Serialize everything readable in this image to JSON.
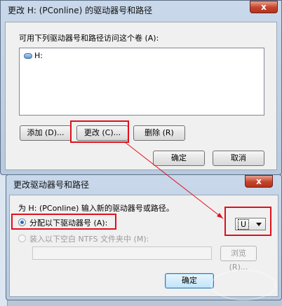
{
  "dialog1": {
    "title": "更改 H: (PConline) 的驱动器号和路径",
    "instruction": "可用下列驱动器号和路径访问这个卷 (A):",
    "list_items": [
      {
        "label": "H:"
      }
    ],
    "add_label": "添加 (D)...",
    "change_label": "更改 (C)...",
    "delete_label": "删除 (R)",
    "ok_label": "确定",
    "cancel_label": "取消"
  },
  "dialog2": {
    "title": "更改驱动器号和路径",
    "close_label": "x",
    "instruction": "为 H: (PConline) 输入新的驱动器号或路径。",
    "assign_label": "分配以下驱动器号 (A):",
    "mount_label": "装入以下空白 NTFS 文件夹中 (M):",
    "drive_letter_value": "U",
    "browse_label": "浏览 (R)...",
    "ok_label": "确定"
  },
  "colors": {
    "annotation_red": "#e0101a",
    "accent_blue": "#1e6fce"
  }
}
